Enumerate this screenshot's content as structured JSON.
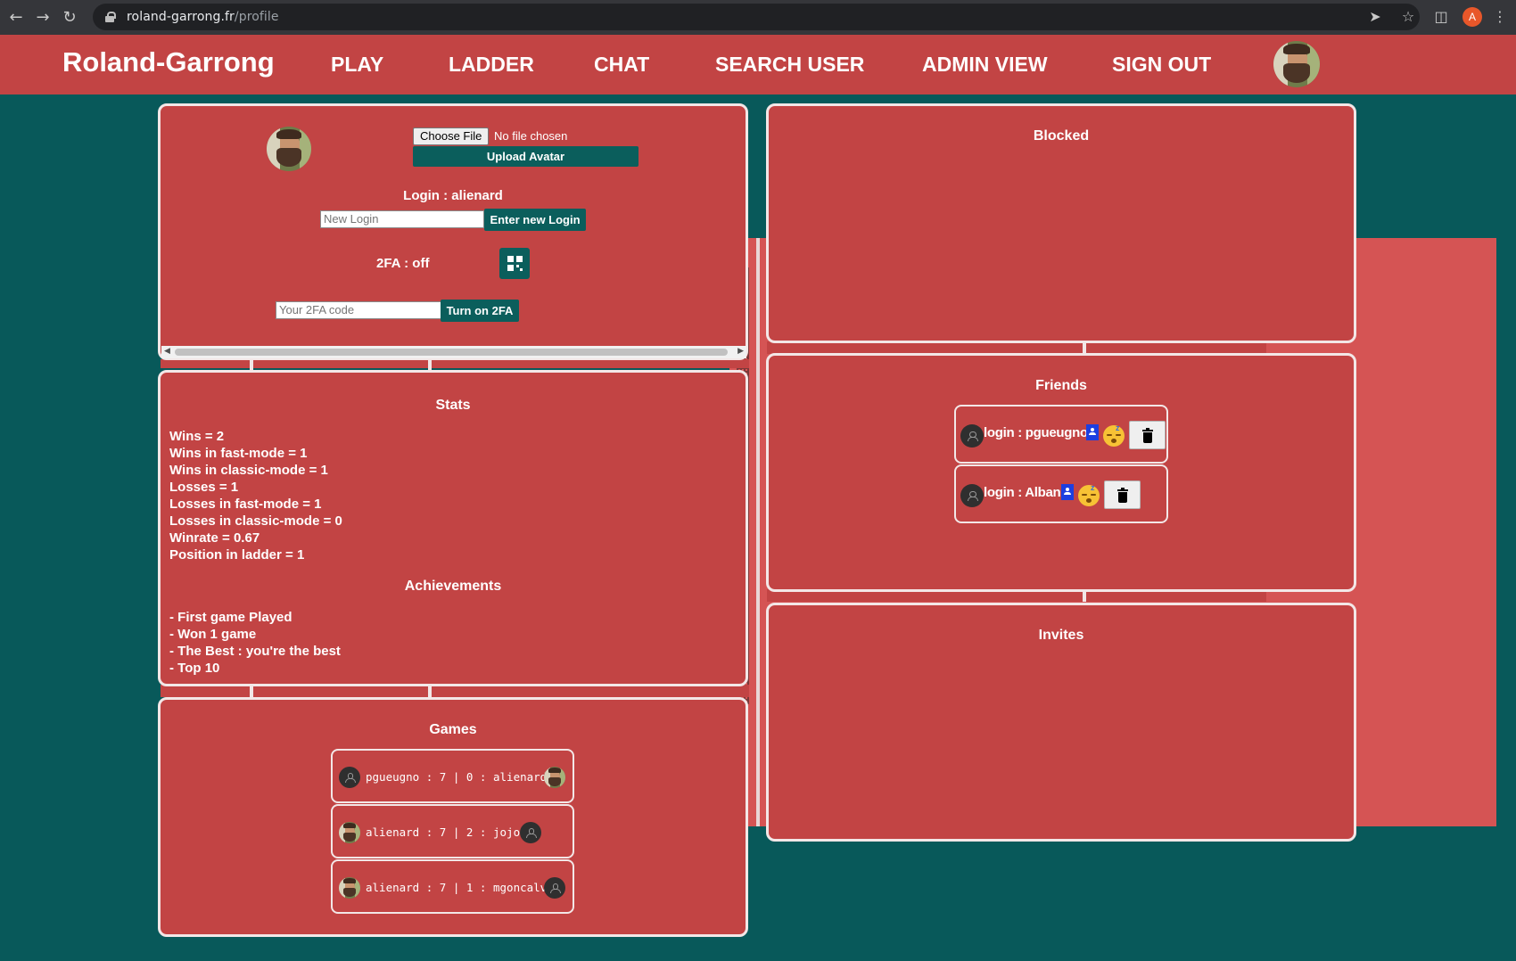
{
  "browser": {
    "url_host": "roland-garrong.fr",
    "url_path": "/profile",
    "profile_initial": "A"
  },
  "navbar": {
    "brand": "Roland-Garrong",
    "links": [
      "PLAY",
      "LADDER",
      "CHAT",
      "SEARCH USER",
      "ADMIN VIEW",
      "SIGN OUT"
    ]
  },
  "profile": {
    "choose_file": "Choose File",
    "no_file": "No file chosen",
    "upload_avatar": "Upload Avatar",
    "login_label": "Login : alienard",
    "new_login_placeholder": "New Login",
    "enter_new_login": "Enter new Login",
    "twofa_label": "2FA : off",
    "twofa_placeholder": "Your 2FA code",
    "turn_on_2fa": "Turn on 2FA"
  },
  "stats": {
    "title": "Stats",
    "lines": [
      "Wins = 2",
      "Wins in fast-mode = 1",
      "Wins in classic-mode = 1",
      "Losses = 1",
      "Losses in fast-mode = 1",
      "Losses in classic-mode = 0",
      "Winrate = 0.67",
      "Position in ladder = 1"
    ],
    "achievements_title": "Achievements",
    "achievements": [
      "- First game Played",
      "- Won 1 game",
      "- The Best : you're the best",
      "- Top 10"
    ]
  },
  "games": {
    "title": "Games",
    "rows": [
      "pgueugno : 7 | 0 : alienard",
      "alienard : 7 | 2 : jojo",
      "alienard : 7 | 1 : mgoncalv"
    ]
  },
  "blocked": {
    "title": "Blocked"
  },
  "friends": {
    "title": "Friends",
    "rows": [
      "login : pgueugno",
      "login : Alban"
    ]
  },
  "invites": {
    "title": "Invites"
  }
}
